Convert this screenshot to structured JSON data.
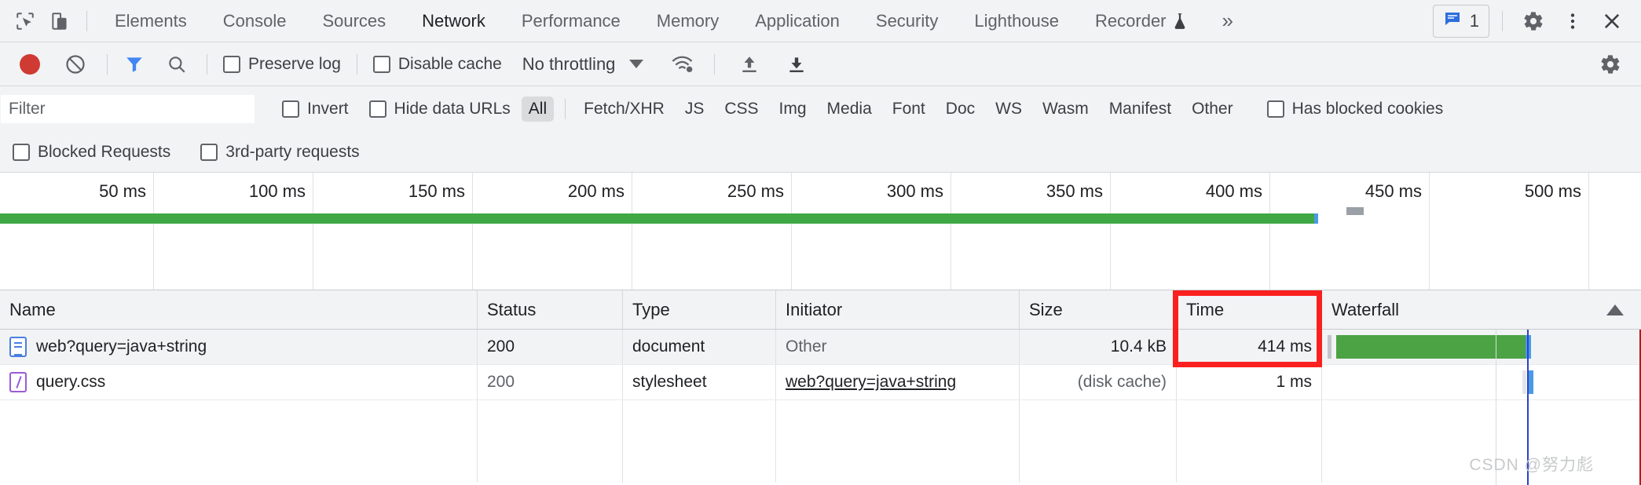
{
  "tabbar": {
    "icons": [
      {
        "name": "inspect-element-icon"
      },
      {
        "name": "device-toolbar-icon"
      }
    ],
    "tabs": [
      {
        "label": "Elements",
        "active": false
      },
      {
        "label": "Console",
        "active": false
      },
      {
        "label": "Sources",
        "active": false
      },
      {
        "label": "Network",
        "active": true
      },
      {
        "label": "Performance",
        "active": false
      },
      {
        "label": "Memory",
        "active": false
      },
      {
        "label": "Application",
        "active": false
      },
      {
        "label": "Security",
        "active": false
      },
      {
        "label": "Lighthouse",
        "active": false
      },
      {
        "label": "Recorder",
        "active": false,
        "badge": "flask-icon"
      }
    ],
    "more_label": "»",
    "message_count": "1",
    "right_icons": [
      "message-icon",
      "settings-gear-icon",
      "more-options-icon",
      "close-icon"
    ]
  },
  "network_toolbar": {
    "record_label": "record-button",
    "clear_label": "clear-button",
    "filter_toggle_label": "filter-button",
    "search_label": "search-button",
    "preserve_log": "Preserve log",
    "disable_cache": "Disable cache",
    "throttling": "No throttling",
    "throttling_settings": "network-conditions-icon",
    "import_har": "import-har-icon",
    "export_har": "export-har-icon",
    "settings": "settings-gear-icon"
  },
  "filter_bar": {
    "filter_placeholder": "Filter",
    "filter_value": "",
    "invert": "Invert",
    "hide_data_urls": "Hide data URLs",
    "types": [
      {
        "label": "All",
        "selected": true
      },
      {
        "label": "Fetch/XHR",
        "selected": false
      },
      {
        "label": "JS",
        "selected": false
      },
      {
        "label": "CSS",
        "selected": false
      },
      {
        "label": "Img",
        "selected": false
      },
      {
        "label": "Media",
        "selected": false
      },
      {
        "label": "Font",
        "selected": false
      },
      {
        "label": "Doc",
        "selected": false
      },
      {
        "label": "WS",
        "selected": false
      },
      {
        "label": "Wasm",
        "selected": false
      },
      {
        "label": "Manifest",
        "selected": false
      },
      {
        "label": "Other",
        "selected": false
      }
    ],
    "has_blocked_cookies": "Has blocked cookies",
    "blocked_requests": "Blocked Requests",
    "third_party_requests": "3rd-party requests"
  },
  "overview": {
    "ticks": [
      "50 ms",
      "100 ms",
      "150 ms",
      "200 ms",
      "250 ms",
      "300 ms",
      "350 ms",
      "400 ms",
      "450 ms",
      "500 ms"
    ],
    "bar_end_ms": 414,
    "bar_color": "#3fa845",
    "blue_marker_color": "#4b9ae5"
  },
  "table": {
    "columns": [
      {
        "label": "Name"
      },
      {
        "label": "Status"
      },
      {
        "label": "Type"
      },
      {
        "label": "Initiator"
      },
      {
        "label": "Size"
      },
      {
        "label": "Time"
      },
      {
        "label": "Waterfall"
      }
    ],
    "sort_indicator": "sort-ascending-icon",
    "highlight_color": "#fb2020",
    "rows": [
      {
        "icon": "document-file-icon",
        "name": "web?query=java+string",
        "status": "200",
        "type": "document",
        "initiator": "Other",
        "initiator_link": false,
        "size": "10.4 kB",
        "time": "414 ms",
        "waterfall": {
          "start_pct": 3,
          "width_pct": 86,
          "bar_color": "#4ba344"
        }
      },
      {
        "icon": "stylesheet-file-icon",
        "name": "query.css",
        "status": "200",
        "type": "stylesheet",
        "initiator": "web?query=java+string",
        "initiator_link": true,
        "size": "(disk cache)",
        "time": "1 ms",
        "waterfall": {
          "start_pct": 86,
          "width_pct": 1,
          "bar_color": "#4b9ae5"
        }
      }
    ]
  },
  "watermark": "CSDN @努力彪"
}
